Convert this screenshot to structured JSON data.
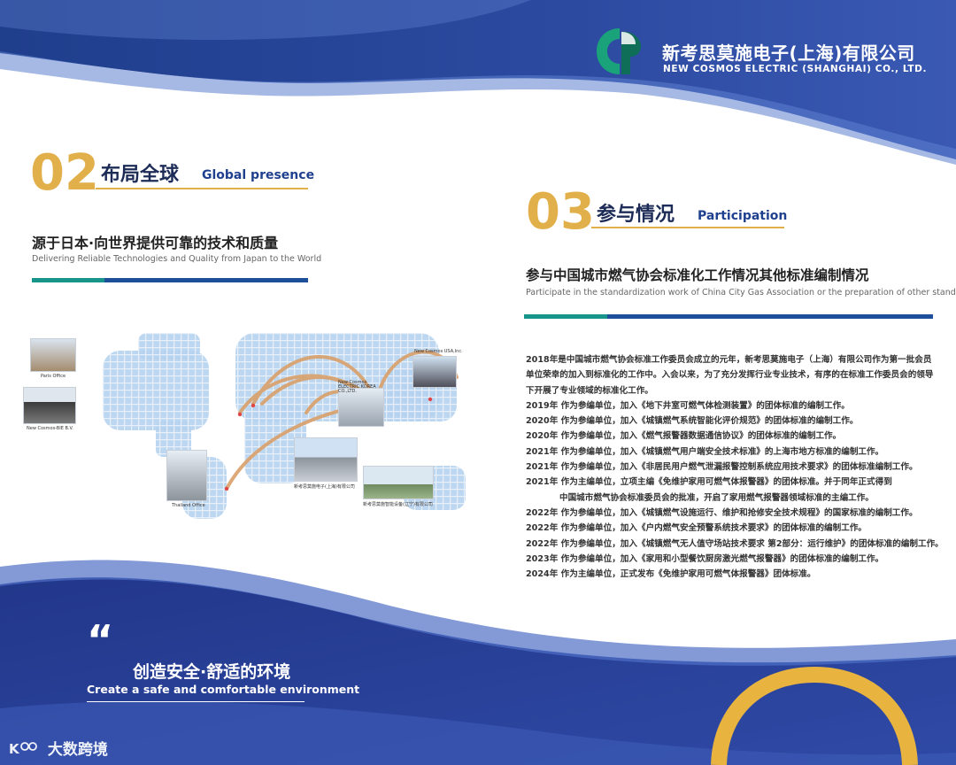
{
  "header": {
    "company_cn": "新考思莫施电子(上海)有限公司",
    "company_en": "NEW COSMOS ELECTRIC (SHANGHAI) CO., LTD.",
    "logo_icon": "company-logo-icon"
  },
  "section2": {
    "number": "02",
    "title_cn": "布局全球",
    "title_en": "Global presence",
    "subtitle_cn": "源于日本·向世界提供可靠的技术和质量",
    "subtitle_en": "Delivering Reliable Technologies and Quality from Japan to the World",
    "map_labels": {
      "paris": "Paris Office",
      "bv": "New Cosmos-BIE B.V.",
      "thailand": "Thailand Office",
      "usa": "New Cosmos USA,Inc.",
      "korea": "New Cosmos ELECTRIC KOREA CO.,LTD.",
      "shanghai": "新考思莫施电子(上海)有限公司",
      "liaoning": "新考思莫施智能设备(辽宁)有限公司"
    }
  },
  "section3": {
    "number": "03",
    "title_cn": "参与情况",
    "title_en": "Participation",
    "subtitle_cn": "参与中国城市燃气协会标准化工作情况其他标准编制情况",
    "subtitle_en": "Participate in the standardization work of China City Gas Association or the preparation of other standards",
    "paragraph_lines": [
      "2018年是中国城市燃气协会标准工作委员会成立的元年，新考思莫施电子（上海）有限公司作为第一批会员",
      "单位荣幸的加入到标准化的工作中。入会以来，为了充分发挥行业专业技术，有序的在标准工作委员会的领导",
      "下开展了专业领域的标准化工作。"
    ],
    "entries": [
      "2019年  作为参编单位，加入《地下井室可燃气体检测装置》的团体标准的编制工作。",
      "2020年  作为参编单位，加入《城镇燃气系统智能化评价规范》的团体标准的编制工作。",
      "2020年  作为参编单位，加入《燃气报警器数据通信协议》的团体标准的编制工作。",
      "2021年  作为参编单位，加入《城镇燃气用户端安全技术标准》的上海市地方标准的编制工作。",
      "2021年  作为参编单位，加入《非居民用户燃气泄漏报警控制系统应用技术要求》的团体标准编制工作。",
      "2021年  作为主编单位，立项主编《免维护家用可燃气体报警器》的团体标准。并于同年正式得到",
      "中国城市燃气协会标准委员会的批准，开启了家用燃气报警器领域标准的主编工作。",
      "2022年  作为参编单位，加入《城镇燃气设施运行、维护和抢修安全技术规程》的国家标准的编制工作。",
      "2022年  作为参编单位，加入《户内燃气安全预警系统技术要求》的团体标准的编制工作。",
      "2022年  作为参编单位，加入《城镇燃气无人值守场站技术要求 第2部分：运行维护》的团体标准的编制工作。",
      "2023年  作为参编单位，加入《家用和小型餐饮厨房激光燃气报警器》的团体标准的编制工作。",
      "2024年  作为主编单位，正式发布《免维护家用可燃气体报警器》团体标准。"
    ]
  },
  "footer": {
    "quote_mark": "“",
    "slogan_cn": "创造安全·舒适的环境",
    "slogan_en": "Create a safe and comfortable environment",
    "watermark": "大数跨境",
    "watermark_icon": "k100-logo-icon"
  },
  "colors": {
    "gold": "#e2b04a",
    "navy": "#1d2b57",
    "blue": "#1d4f9b",
    "teal": "#17958b",
    "map_blue": "#9fc3e6"
  }
}
